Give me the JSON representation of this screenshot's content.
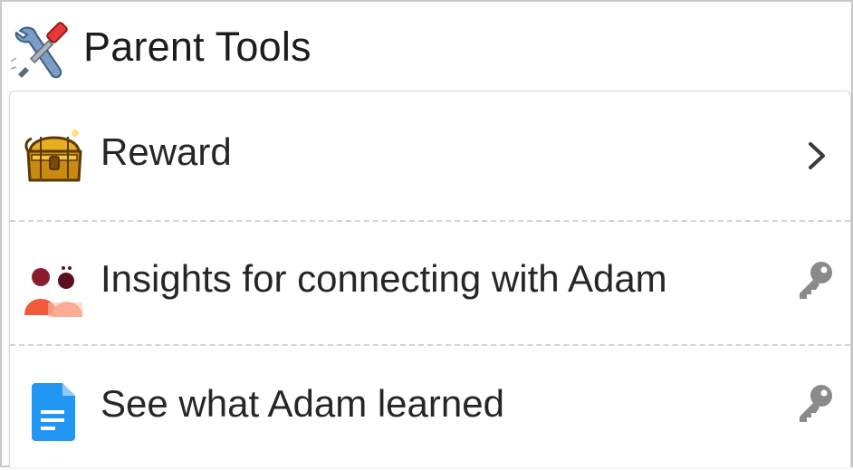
{
  "header": {
    "title": "Parent Tools",
    "icon": "tools-icon"
  },
  "items": [
    {
      "label": "Reward",
      "icon": "treasure-chest-icon",
      "trailing_icon": "chevron-right-icon"
    },
    {
      "label": "Insights for connecting with Adam",
      "icon": "parent-child-icon",
      "trailing_icon": "key-icon"
    },
    {
      "label": "See what Adam learned",
      "icon": "document-icon",
      "trailing_icon": "key-icon"
    }
  ],
  "colors": {
    "title_text": "#1c1c1c",
    "label_text": "#262626",
    "key_gray": "#8a8a8a",
    "document_blue": "#2196f3",
    "people_red": "#ef5a3c",
    "people_dark": "#8b1c2e",
    "chest_gold": "#e0a21a"
  }
}
